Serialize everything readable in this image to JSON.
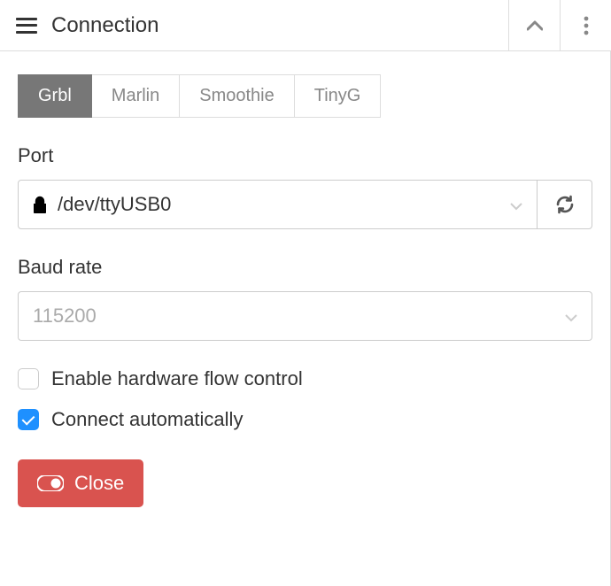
{
  "header": {
    "title": "Connection"
  },
  "tabs": [
    {
      "label": "Grbl",
      "active": true
    },
    {
      "label": "Marlin",
      "active": false
    },
    {
      "label": "Smoothie",
      "active": false
    },
    {
      "label": "TinyG",
      "active": false
    }
  ],
  "port": {
    "label": "Port",
    "value": "/dev/ttyUSB0"
  },
  "baud": {
    "label": "Baud rate",
    "value": "115200"
  },
  "flow_control": {
    "label": "Enable hardware flow control",
    "checked": false
  },
  "auto_connect": {
    "label": "Connect automatically",
    "checked": true
  },
  "close_button": "Close"
}
